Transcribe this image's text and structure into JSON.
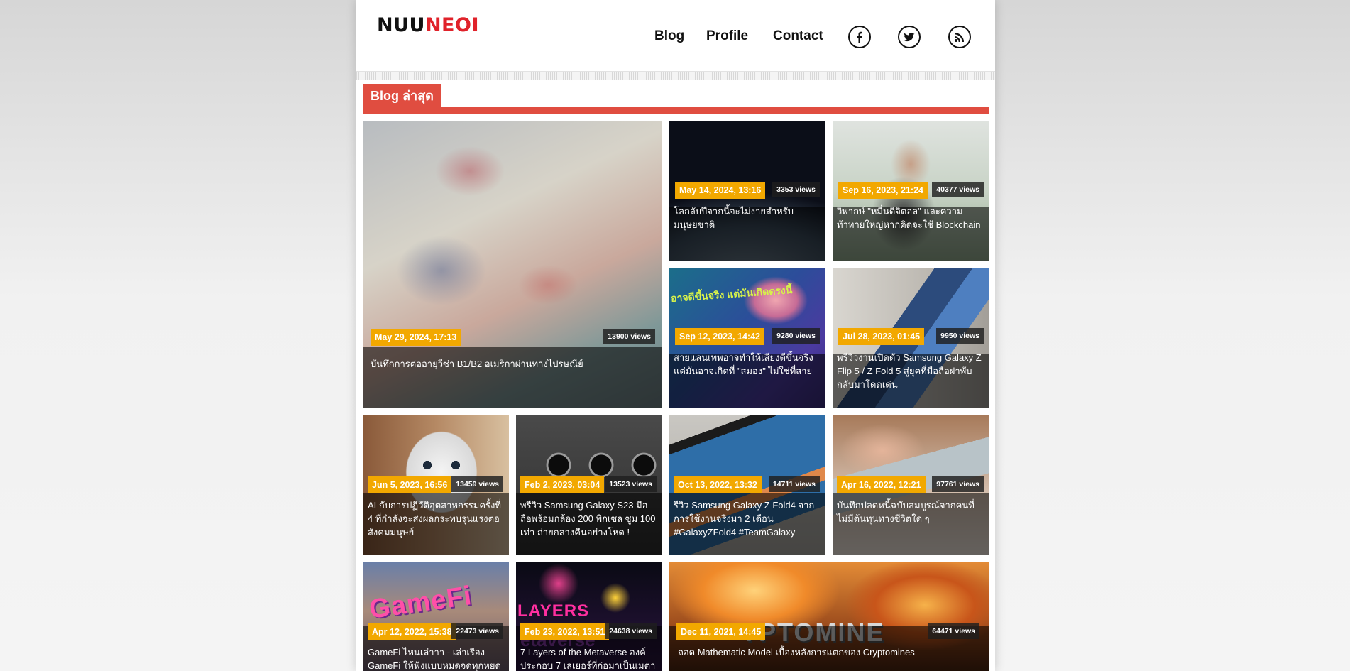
{
  "site": {
    "logo_part1": "NUU",
    "logo_part2": "NEOI",
    "nav": [
      "Blog",
      "Profile",
      "Contact"
    ],
    "social_icons": [
      "facebook-icon",
      "twitter-icon",
      "rss-icon"
    ]
  },
  "section": {
    "title": "Blog ล่าสุด"
  },
  "colors": {
    "accent": "#e04d40",
    "date_badge": "#f2a800",
    "brand_red": "#e0222a"
  },
  "posts": [
    {
      "date": "May 29, 2024, 17:13",
      "views": "13900 views",
      "title": "บันทึกการต่ออายุวีซ่า B1/B2 อเมริกาผ่านทางไปรษณีย์"
    },
    {
      "date": "May 14, 2024, 13:16",
      "views": "3353 views",
      "title": "โลกลับปีจากนี้จะไม่ง่ายสำหรับมนุษยชาติ"
    },
    {
      "date": "Sep 16, 2023, 21:24",
      "views": "40377 views",
      "title": "วิพากษ์ \"หมื่นดิจิตอล\" และความท้าทายใหญ่หากคิดจะใช้ Blockchain"
    },
    {
      "date": "Sep 12, 2023, 14:42",
      "views": "9280 views",
      "title": "สายแลนเทพอาจทำให้เสียงดีขึ้นจริง แต่มันอาจเกิดที่ \"สมอง\" ไม่ใช่ที่สาย"
    },
    {
      "date": "Jul 28, 2023, 01:45",
      "views": "9950 views",
      "title": "พรีวิวงานเปิดตัว Samsung Galaxy Z Flip 5 / Z Fold 5 สู่ยุคที่มือถือฝาพับกลับมาโดดเด่น"
    },
    {
      "date": "Jun 5, 2023, 16:56",
      "views": "13459 views",
      "title": "AI กับการปฏิวัติอุตสาหกรรมครั้งที่ 4 ที่กำลังจะส่งผลกระทบรุนแรงต่อสังคมมนุษย์"
    },
    {
      "date": "Feb 2, 2023, 03:04",
      "views": "13523 views",
      "title": "พรีวิว Samsung Galaxy S23 มือถือพร้อมกล้อง 200 พิกเซล ซูม 100 เท่า ถ่ายกลางคืนอย่างโหด !"
    },
    {
      "date": "Oct 13, 2022, 13:32",
      "views": "14711 views",
      "title": "รีวิว Samsung Galaxy Z Fold4 จากการใช้งานจริงมา 2 เดือน #GalaxyZFold4 #TeamGalaxy"
    },
    {
      "date": "Apr 16, 2022, 12:21",
      "views": "97761 views",
      "title": "บันทึกปลดหนี้ฉบับสมบูรณ์จากคนที่ไม่มีต้นทุนทางชีวิตใด ๆ"
    },
    {
      "date": "Apr 12, 2022, 15:38",
      "views": "22473 views",
      "title": "GameFi ไหนเล่าาา - เล่าเรื่อง GameFi ให้ฟังแบบหมดจดทุกหยด"
    },
    {
      "date": "Feb 23, 2022, 13:51",
      "views": "24638 views",
      "title": "7 Layers of the Metaverse องค์ประกอบ 7 เลเยอร์ที่ก่อมาเป็นเมตา"
    },
    {
      "date": "Dec 11, 2021, 14:45",
      "views": "64471 views",
      "title": "ถอด Mathematic Model เบื้องหลังการแตกของ Cryptomines"
    }
  ],
  "image_texts": {
    "gamefi": "GameFi",
    "layers": "LAYERS",
    "metaverse": "etaverse",
    "cryptomines": "YPTOMINE",
    "brain_caption": "อาจดีขึ้นจริง แต่มันเกิดตรงนี้"
  }
}
